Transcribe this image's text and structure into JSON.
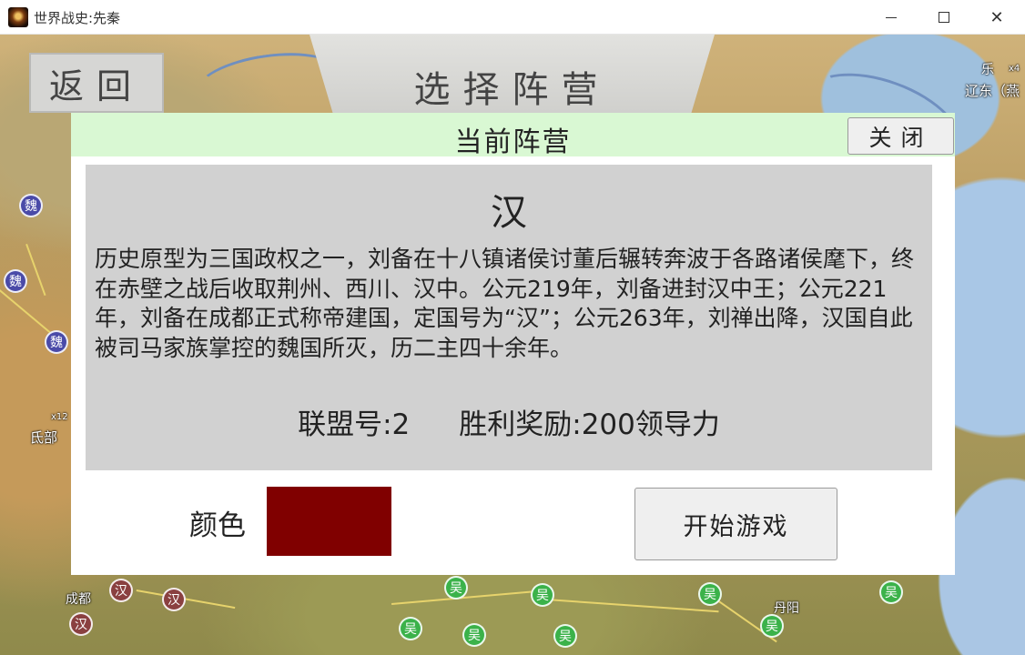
{
  "window": {
    "title": "世界战史:先秦",
    "minimize_glyph": "",
    "close_glyph": "✕"
  },
  "top_banner": {
    "title": "选择阵营"
  },
  "back_button": {
    "label": "返回"
  },
  "map_labels": [
    {
      "name": "map-label-liaodong",
      "text": "辽东（燕"
    },
    {
      "name": "map-label-dibu",
      "text": "氐部"
    },
    {
      "name": "map-label-chengdu",
      "text": "成都"
    },
    {
      "name": "map-label-yue",
      "text": "乐"
    },
    {
      "name": "map-label-danyang",
      "text": "丹阳"
    },
    {
      "name": "map-label-x4",
      "text": "x4"
    },
    {
      "name": "map-label-x12",
      "text": "x12"
    }
  ],
  "map_cities": [
    {
      "name": "city-wei-1",
      "faction": "wei",
      "text": "魏"
    },
    {
      "name": "city-wei-2",
      "faction": "wei",
      "text": "魏"
    },
    {
      "name": "city-wei-3",
      "faction": "wei",
      "text": "魏"
    },
    {
      "name": "city-han-1",
      "faction": "han",
      "text": "汉"
    },
    {
      "name": "city-han-2",
      "faction": "han",
      "text": "汉"
    },
    {
      "name": "city-han-3",
      "faction": "han",
      "text": "汉"
    },
    {
      "name": "city-wu-1",
      "faction": "wu",
      "text": "吴"
    },
    {
      "name": "city-wu-2",
      "faction": "wu",
      "text": "吴"
    },
    {
      "name": "city-wu-3",
      "faction": "wu",
      "text": "吴"
    },
    {
      "name": "city-wu-4",
      "faction": "wu",
      "text": "吴"
    },
    {
      "name": "city-wu-5",
      "faction": "wu",
      "text": "吴"
    },
    {
      "name": "city-wu-6",
      "faction": "wu",
      "text": "吴"
    },
    {
      "name": "city-wu-7",
      "faction": "wu",
      "text": "吴"
    },
    {
      "name": "city-wu-8",
      "faction": "wu",
      "text": "吴"
    }
  ],
  "dialog": {
    "title": "当前阵营",
    "close_label": "关闭",
    "faction_name": "汉",
    "description": "历史原型为三国政权之一，刘备在十八镇诸侯讨董后辗转奔波于各路诸侯麾下，终在赤壁之战后收取荆州、西川、汉中。公元219年，刘备进封汉中王；公元221年，刘备在成都正式称帝建国，定国号为“汉”；公元263年，刘禅出降，汉国自此被司马家族掌控的魏国所灭，历二主四十余年。",
    "alliance": "联盟号:2",
    "reward": "胜利奖励:200领导力",
    "color_label": "颜色",
    "faction_color": "#800000",
    "start_label": "开始游戏"
  },
  "colors": {
    "header_bg": "#d9f8d3",
    "panel_bg": "#d1d1d1",
    "wu": "#3bb24a",
    "han": "#8a4040",
    "wei": "#4a4aa8"
  }
}
